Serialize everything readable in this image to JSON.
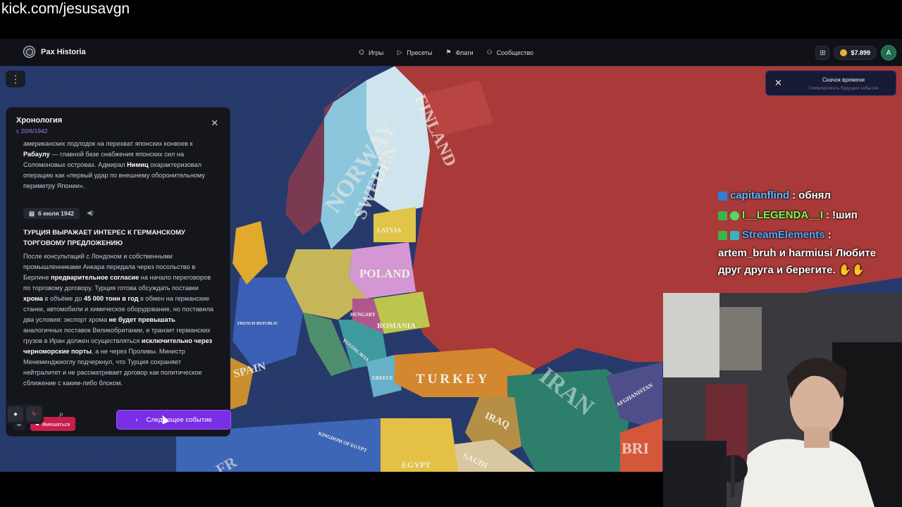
{
  "stream": {
    "url": "kick.com/jesusavgn"
  },
  "app": {
    "name": "Pax Historia",
    "nav": [
      {
        "icon": "controller-icon",
        "glyph": "⌬",
        "label": "Игры"
      },
      {
        "icon": "play-icon",
        "glyph": "▷",
        "label": "Пресеты"
      },
      {
        "icon": "flag-icon",
        "glyph": "⚑",
        "label": "Флаги"
      },
      {
        "icon": "users-icon",
        "glyph": "⚇",
        "label": "Сообщество"
      }
    ],
    "balance": "$7.899",
    "avatar_letter": "A"
  },
  "time_skip": {
    "title": "Скачок времени",
    "subtitle": "Симулировать будущие события"
  },
  "timeline": {
    "title": "Хронология",
    "date": "с 20/6/1942",
    "prev_text_parts": [
      "американских подлодок на перехват японских конвоев к ",
      "Рабаулу",
      " — главной базе снабжения японских сил на Соломоновых островах. Адмирал ",
      "Нимиц",
      " охарактеризовал операцию как «первый удар по внешнему оборонительному периметру Японии»."
    ],
    "event": {
      "date": "6 июля 1942",
      "title": "ТУРЦИЯ ВЫРАЖАЕТ ИНТЕРЕС К ГЕРМАНСКОМУ ТОРГОВОМУ ПРЕДЛОЖЕНИЮ",
      "text_parts": [
        "После консультаций с Лондоном и собственными промышленниками Анкара передала через посольство в Берлине ",
        "предварительное согласие",
        " на начало переговоров по торговому договору. Турция готова обсуждать поставки ",
        "хрома",
        " в объёме до ",
        "45 000 тонн в год",
        " в обмен на германские станки, автомобили и химическое оборудование, но поставила два условия: экспорт хрома ",
        "не будет превышать",
        " аналогичных поставок Великобритании, и транзит германских грузов в Иран должен осуществляться ",
        "исключительно через черноморские порты",
        ", а не через Проливы. Министр Менеменджиоглу подчеркнул, что Турция сохраняет нейтралитет и не рассматривает договор как политическое сближение с каким-либо блоком."
      ]
    },
    "intervene_label": "Вмешаться",
    "next_label": "Следующее событие"
  },
  "map": {
    "labels": [
      "NORWAY",
      "SWEDEN",
      "FINLAND",
      "LATVIA",
      "POLAND",
      "ROMANIA",
      "HUNGARY",
      "YUGOSLAVIA",
      "GREECE",
      "TURKEY",
      "IRAN",
      "IRAQ",
      "SPAIN",
      "FRENCH REPUBLIC",
      "KINGDOM OF EGYPT",
      "AFGHANISTAN",
      "SAUDI",
      "EGYPT",
      "BRI",
      "FR"
    ]
  },
  "chat": [
    {
      "user": "capitanflind",
      "sep": " : ",
      "message": "обнял"
    },
    {
      "user": "I__LEGENDA__I",
      "sep": " : ",
      "message": "!шип"
    },
    {
      "user": "StreamElements",
      "sep": " :",
      "message": "artem_bruh и harmiusi Любите друг друга и берегите. ✋✋"
    }
  ]
}
